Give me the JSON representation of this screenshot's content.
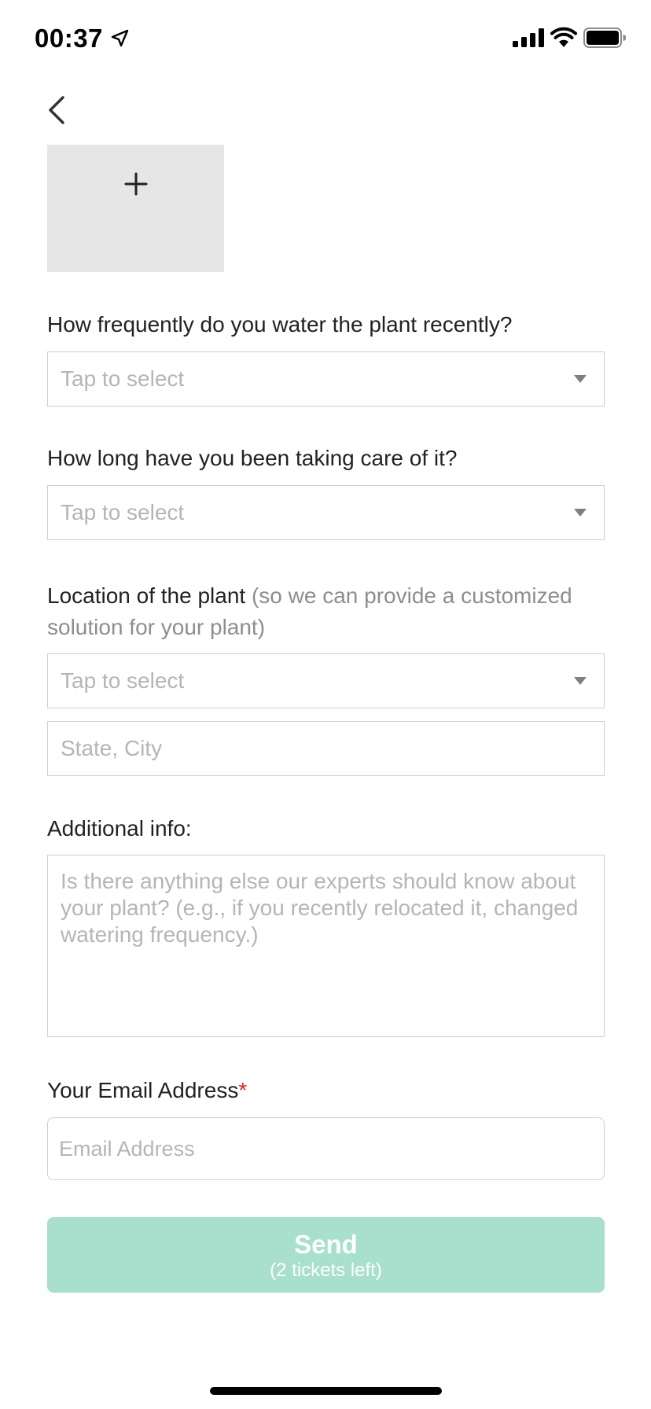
{
  "status_bar": {
    "time": "00:37"
  },
  "photo": {
    "add_icon": "plus-icon"
  },
  "questions": {
    "watering": {
      "label": "How frequently do you water the plant recently?",
      "placeholder": "Tap to select"
    },
    "care_duration": {
      "label": "How long have you been taking care of it?",
      "placeholder": "Tap to select"
    },
    "location": {
      "label": "Location of the plant",
      "label_note": "(so we can provide a customized solution for your plant)",
      "placeholder": "Tap to select",
      "city_placeholder": "State, City"
    },
    "additional": {
      "label": "Additional info:",
      "placeholder": "Is there anything else our experts should know about your plant? (e.g., if you recently relocated it, changed watering frequency.)"
    },
    "email": {
      "label": "Your Email Address",
      "required_mark": "*",
      "placeholder": "Email Address"
    }
  },
  "send_button": {
    "label": "Send",
    "sublabel": "(2 tickets left)"
  },
  "colors": {
    "send_bg": "#a8dfcd",
    "placeholder": "#b5b5b5",
    "required": "#e02020"
  }
}
